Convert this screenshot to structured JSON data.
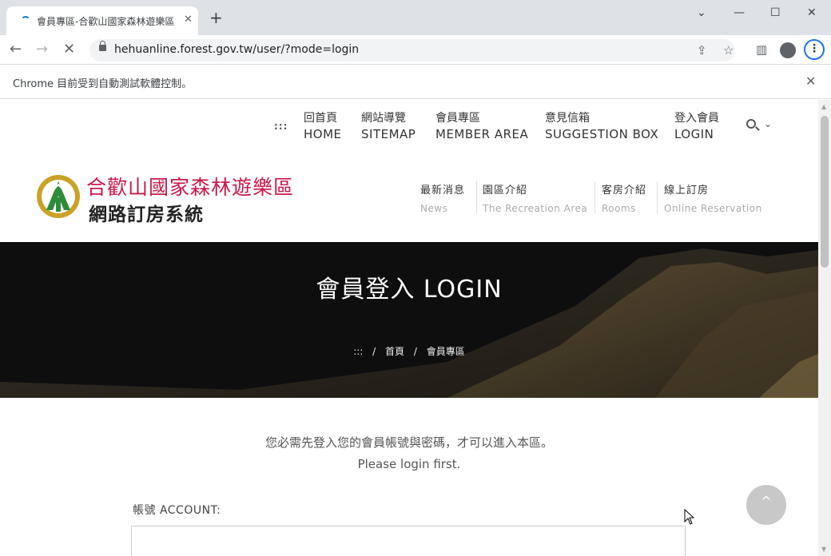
{
  "browser": {
    "tab_title": "會員專區-合歡山國家森林遊樂區",
    "tab_close": "✕",
    "new_tab": "+",
    "url": "hehuanline.forest.gov.tw/user/?mode=login",
    "infobar_text": "Chrome 目前受到自動測試軟體控制。",
    "infobar_close": "✕",
    "window_controls": [
      "⌄",
      "—",
      "☐",
      "✕"
    ],
    "nav": {
      "back": "←",
      "forward": "→",
      "stop": "✕"
    },
    "menu": "⋮"
  },
  "site": {
    "top_nav_dots": ":::",
    "top_nav": [
      {
        "zh": "回首頁",
        "en": "HOME"
      },
      {
        "zh": "網站導覽",
        "en": "SITEMAP"
      },
      {
        "zh": "會員專區",
        "en": "MEMBER AREA"
      },
      {
        "zh": "意見信箱",
        "en": "SUGGESTION BOX"
      },
      {
        "zh": "登入會員",
        "en": "LOGIN"
      }
    ],
    "search_chevron": "⌄",
    "logo_title": "合歡山國家森林遊樂區",
    "logo_subtitle": "網路訂房系統",
    "main_nav": [
      {
        "zh": "最新消息",
        "en": "News"
      },
      {
        "zh": "園區介紹",
        "en": "The Recreation Area"
      },
      {
        "zh": "客房介紹",
        "en": "Rooms"
      },
      {
        "zh": "線上訂房",
        "en": "Online Reservation"
      }
    ],
    "colors": {
      "logo_title": "#c9184a",
      "logo_green": "#2e8b3a",
      "logo_gold": "#c9a227"
    }
  },
  "banner": {
    "title": "會員登入 LOGIN",
    "breadcrumb": [
      ":::",
      "/",
      "首頁",
      "/",
      "會員專區"
    ]
  },
  "login": {
    "message_zh": "您必需先登入您的會員帳號與密碼，才可以進入本區。",
    "message_en": "Please login first.",
    "account_label": "帳號 ACCOUNT:",
    "account_value": "",
    "back_to_top": "^"
  }
}
